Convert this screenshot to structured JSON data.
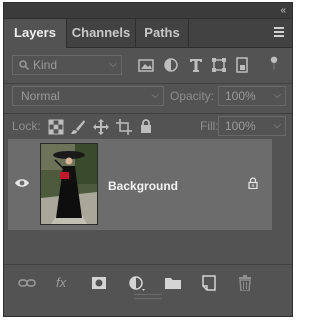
{
  "panel": {
    "collapse_glyph": "«",
    "tabs": [
      {
        "label": "Layers",
        "active": true
      },
      {
        "label": "Channels",
        "active": false
      },
      {
        "label": "Paths",
        "active": false
      }
    ]
  },
  "filter": {
    "kind_label": "Kind",
    "icons": [
      "image-filter-icon",
      "adjustment-filter-icon",
      "type-filter-icon",
      "shape-filter-icon",
      "smart-object-filter-icon"
    ]
  },
  "blend": {
    "mode": "Normal",
    "opacity_label": "Opacity:",
    "opacity_value": "100%"
  },
  "locks": {
    "label": "Lock:",
    "fill_label": "Fill:",
    "fill_value": "100%"
  },
  "layers": [
    {
      "name": "Background",
      "visible": true,
      "locked": true
    }
  ],
  "footer": {
    "fx_label": "fx",
    "icons": [
      "link-layers-icon",
      "layer-style-icon",
      "add-mask-icon",
      "adjustment-layer-icon",
      "group-folder-icon",
      "new-layer-icon",
      "trash-icon"
    ]
  },
  "colors": {
    "panel_bg": "#535353",
    "tab_bar_bg": "#424242",
    "selected_layer_bg": "#6c6c6c"
  }
}
